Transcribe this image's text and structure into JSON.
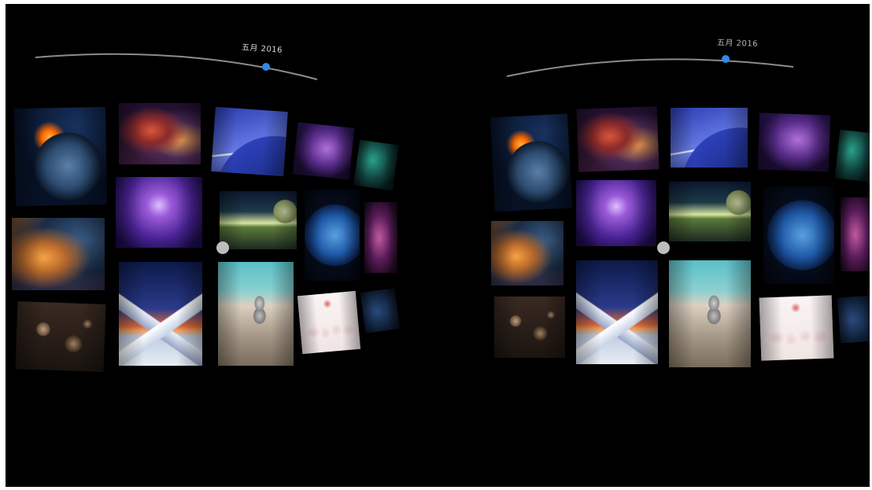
{
  "app": {
    "type": "vr-photo-gallery",
    "view_mode": "stereoscopic-side-by-side"
  },
  "timeline": {
    "left_label": "五月 2016",
    "right_label": "五月 2016",
    "accent_color": "#2f8be6",
    "track_color": "#8c8c8c"
  },
  "gallery": {
    "columns": 5,
    "rows": 3,
    "tiles": [
      {
        "name": "planet-fire",
        "icon": "photo-thumbnail"
      },
      {
        "name": "nebula-red",
        "icon": "photo-thumbnail"
      },
      {
        "name": "planet-arc",
        "icon": "photo-thumbnail"
      },
      {
        "name": "nebula-violet",
        "icon": "photo-thumbnail"
      },
      {
        "name": "nebula-teal",
        "icon": "photo-thumbnail"
      },
      {
        "name": "nebula-orange",
        "icon": "photo-thumbnail"
      },
      {
        "name": "nebula-purple",
        "icon": "photo-thumbnail"
      },
      {
        "name": "horizon",
        "icon": "photo-thumbnail"
      },
      {
        "name": "earth",
        "icon": "photo-thumbnail"
      },
      {
        "name": "pink-nebula",
        "icon": "photo-thumbnail"
      },
      {
        "name": "asteroids",
        "icon": "photo-thumbnail"
      },
      {
        "name": "mountain",
        "icon": "photo-thumbnail"
      },
      {
        "name": "stones",
        "icon": "photo-thumbnail"
      },
      {
        "name": "girls",
        "icon": "photo-thumbnail"
      },
      {
        "name": "dark-blue",
        "icon": "photo-thumbnail"
      }
    ]
  },
  "gaze_cursor": {
    "color": "#bdbdbd"
  }
}
